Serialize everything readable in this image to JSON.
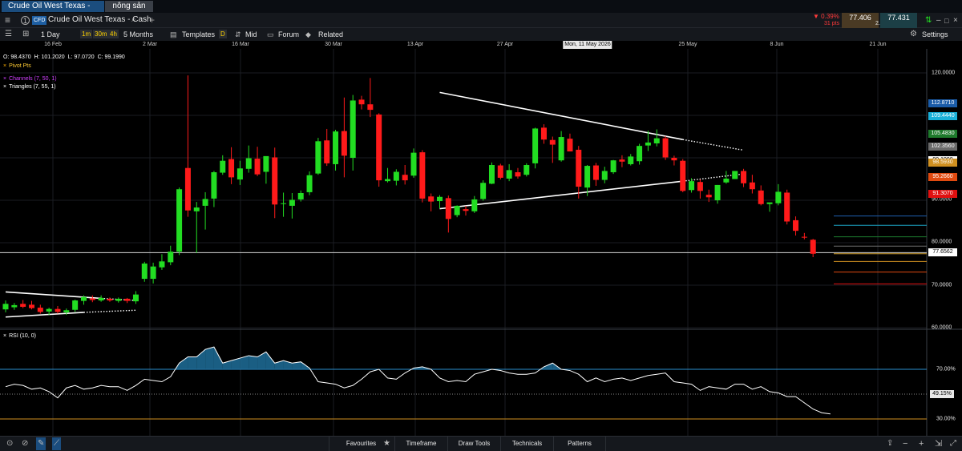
{
  "tabs": [
    {
      "label": "Crude Oil West Texas - Cash",
      "active": true
    },
    {
      "label": "nông sản",
      "active": false
    }
  ],
  "instrument": {
    "number": "1",
    "type_badge": "CFD",
    "name": "Crude Oil West Texas - Cash"
  },
  "quote": {
    "change_pct": "▼ 0.39%",
    "change_pts": "31 pts",
    "sell": "77.406",
    "spread": "2.5",
    "buy": "77.431"
  },
  "toolbar": {
    "timeframe": "1 Day",
    "quick_intervals": [
      "1m",
      "30m",
      "4h"
    ],
    "range": "5 Months",
    "templates": "Templates",
    "d_flag": "D",
    "mid": "Mid",
    "forum": "Forum",
    "related": "Related",
    "settings": "Settings"
  },
  "x_axis": {
    "labels": [
      "16 Feb",
      "2 Mar",
      "16 Mar",
      "30 Mar",
      "13 Apr",
      "27 Apr",
      "25 May",
      "8 Jun",
      "21 Jun"
    ],
    "crosshair_label": "Mon, 11 May 2026"
  },
  "ohlc": {
    "open": "O: 98.4370",
    "high": "H: 101.2020",
    "low": "L: 97.0720",
    "close": "C: 99.1990"
  },
  "indicators": {
    "pivot": "Pivot Pts",
    "channels": "Channels (7, 50, 1)",
    "triangles": "Triangles (7, 55, 1)",
    "rsi": "RSI (10, 0)"
  },
  "price_axis": {
    "labels": [
      "120.0000",
      "90.0000",
      "80.0000",
      "70.0000",
      "60.0000"
    ],
    "tags": [
      {
        "text": "112.8710",
        "color": "#1b5ca8"
      },
      {
        "text": "109.4440",
        "color": "#1ab0d8"
      },
      {
        "text": "105.4830",
        "color": "#1e7a2c"
      },
      {
        "text": "102.3560",
        "color": "#6b6b6b"
      },
      {
        "text": "99.1990",
        "color": "#ffffff"
      },
      {
        "text": "98.5930",
        "color": "#d09020"
      },
      {
        "text": "95.2660",
        "color": "#e04a10"
      },
      {
        "text": "91.3070",
        "color": "#e01010"
      },
      {
        "text": "77.6562",
        "color": "#ffffff"
      }
    ]
  },
  "rsi_axis": {
    "labels": [
      "70.00%",
      "30.00%"
    ],
    "current": "49.15%",
    "overbought": 70,
    "oversold": 30
  },
  "bottom_bar": {
    "items": [
      "Favourites",
      "Timeframe",
      "Draw Tools",
      "Technicals",
      "Patterns"
    ]
  },
  "colors": {
    "bull": "#22dd22",
    "bear": "#ff1a1a",
    "panel": "#15181d",
    "accent_blue": "#1b4d7e"
  },
  "chart_data": {
    "type": "candlestick",
    "instrument": "Crude Oil West Texas - Cash",
    "interval": "1 Day",
    "y_range": [
      60,
      125
    ],
    "candles": [
      {
        "o": 64.3,
        "h": 66.4,
        "l": 63.6,
        "c": 65.6
      },
      {
        "o": 64.8,
        "h": 65.8,
        "l": 64.2,
        "c": 65.3
      },
      {
        "o": 65.6,
        "h": 66.5,
        "l": 64.6,
        "c": 64.9
      },
      {
        "o": 65.4,
        "h": 66.3,
        "l": 64.3,
        "c": 64.6
      },
      {
        "o": 64.7,
        "h": 65.4,
        "l": 63.3,
        "c": 63.7
      },
      {
        "o": 63.8,
        "h": 64.7,
        "l": 63.0,
        "c": 64.4
      },
      {
        "o": 64.4,
        "h": 65.1,
        "l": 63.3,
        "c": 63.7
      },
      {
        "o": 63.6,
        "h": 64.5,
        "l": 63.0,
        "c": 64.1
      },
      {
        "o": 64.2,
        "h": 66.6,
        "l": 63.7,
        "c": 66.4
      },
      {
        "o": 66.3,
        "h": 67.6,
        "l": 65.4,
        "c": 67.2
      },
      {
        "o": 66.9,
        "h": 67.6,
        "l": 66.0,
        "c": 66.5
      },
      {
        "o": 66.4,
        "h": 67.6,
        "l": 66.1,
        "c": 67.0
      },
      {
        "o": 66.8,
        "h": 67.1,
        "l": 66.1,
        "c": 66.4
      },
      {
        "o": 66.3,
        "h": 67.1,
        "l": 65.9,
        "c": 66.8
      },
      {
        "o": 66.8,
        "h": 67.0,
        "l": 65.8,
        "c": 66.3
      },
      {
        "o": 66.2,
        "h": 68.6,
        "l": 65.6,
        "c": 67.8
      },
      {
        "o": 71.5,
        "h": 75.5,
        "l": 70.8,
        "c": 75.1
      },
      {
        "o": 71.5,
        "h": 75.3,
        "l": 70.4,
        "c": 74.4
      },
      {
        "o": 74.2,
        "h": 77.3,
        "l": 73.6,
        "c": 75.6
      },
      {
        "o": 75.4,
        "h": 79.3,
        "l": 74.7,
        "c": 77.9
      },
      {
        "o": 77.9,
        "h": 93.0,
        "l": 77.1,
        "c": 92.6
      },
      {
        "o": 97.6,
        "h": 119.4,
        "l": 86.1,
        "c": 87.6
      },
      {
        "o": 87.4,
        "h": 89.6,
        "l": 77.6,
        "c": 88.3
      },
      {
        "o": 88.7,
        "h": 91.9,
        "l": 83.1,
        "c": 90.3
      },
      {
        "o": 90.4,
        "h": 96.9,
        "l": 88.4,
        "c": 96.6
      },
      {
        "o": 96.5,
        "h": 100.6,
        "l": 96.0,
        "c": 99.3
      },
      {
        "o": 99.7,
        "h": 102.5,
        "l": 93.8,
        "c": 95.4
      },
      {
        "o": 94.9,
        "h": 99.3,
        "l": 93.6,
        "c": 97.5
      },
      {
        "o": 97.4,
        "h": 102.9,
        "l": 96.5,
        "c": 99.9
      },
      {
        "o": 99.8,
        "h": 102.6,
        "l": 95.7,
        "c": 96.1
      },
      {
        "o": 96.7,
        "h": 100.3,
        "l": 93.9,
        "c": 100.4
      },
      {
        "o": 100.1,
        "h": 102.4,
        "l": 85.8,
        "c": 89.0
      },
      {
        "o": 89.3,
        "h": 91.8,
        "l": 86.1,
        "c": 89.3
      },
      {
        "o": 88.7,
        "h": 91.7,
        "l": 85.7,
        "c": 90.1
      },
      {
        "o": 90.2,
        "h": 92.3,
        "l": 89.7,
        "c": 91.7
      },
      {
        "o": 91.9,
        "h": 96.8,
        "l": 91.2,
        "c": 95.9
      },
      {
        "o": 96.3,
        "h": 104.7,
        "l": 96.0,
        "c": 103.9
      },
      {
        "o": 104.1,
        "h": 106.8,
        "l": 98.1,
        "c": 98.7
      },
      {
        "o": 98.5,
        "h": 106.6,
        "l": 97.0,
        "c": 106.2
      },
      {
        "o": 106.3,
        "h": 114.2,
        "l": 95.4,
        "c": 100.5
      },
      {
        "o": 100.0,
        "h": 114.8,
        "l": 97.0,
        "c": 113.5
      },
      {
        "o": 113.7,
        "h": 114.6,
        "l": 111.4,
        "c": 112.6
      },
      {
        "o": 112.6,
        "h": 118.8,
        "l": 109.6,
        "c": 111.3
      },
      {
        "o": 110.2,
        "h": 110.5,
        "l": 93.2,
        "c": 94.7
      },
      {
        "o": 94.5,
        "h": 97.6,
        "l": 94.2,
        "c": 95.0
      },
      {
        "o": 94.6,
        "h": 97.3,
        "l": 93.5,
        "c": 96.7
      },
      {
        "o": 96.0,
        "h": 98.3,
        "l": 93.7,
        "c": 94.7
      },
      {
        "o": 95.8,
        "h": 102.2,
        "l": 95.3,
        "c": 101.2
      },
      {
        "o": 101.3,
        "h": 101.8,
        "l": 89.5,
        "c": 90.4
      },
      {
        "o": 90.9,
        "h": 91.6,
        "l": 87.4,
        "c": 89.7
      },
      {
        "o": 89.8,
        "h": 91.2,
        "l": 88.1,
        "c": 90.8
      },
      {
        "o": 90.5,
        "h": 91.1,
        "l": 82.4,
        "c": 85.6
      },
      {
        "o": 86.5,
        "h": 88.8,
        "l": 86.0,
        "c": 88.7
      },
      {
        "o": 87.9,
        "h": 88.7,
        "l": 86.4,
        "c": 87.5
      },
      {
        "o": 87.4,
        "h": 91.0,
        "l": 87.0,
        "c": 90.2
      },
      {
        "o": 90.3,
        "h": 94.7,
        "l": 89.9,
        "c": 94.1
      },
      {
        "o": 93.9,
        "h": 98.9,
        "l": 93.8,
        "c": 98.3
      },
      {
        "o": 98.2,
        "h": 98.6,
        "l": 94.9,
        "c": 95.3
      },
      {
        "o": 95.1,
        "h": 98.5,
        "l": 94.5,
        "c": 97.1
      },
      {
        "o": 96.6,
        "h": 97.6,
        "l": 95.1,
        "c": 95.6
      },
      {
        "o": 96.0,
        "h": 98.7,
        "l": 95.6,
        "c": 98.3
      },
      {
        "o": 98.7,
        "h": 107.1,
        "l": 97.5,
        "c": 106.9
      },
      {
        "o": 107.1,
        "h": 107.9,
        "l": 103.3,
        "c": 104.3
      },
      {
        "o": 104.2,
        "h": 105.0,
        "l": 98.8,
        "c": 103.1
      },
      {
        "o": 99.4,
        "h": 106.3,
        "l": 99.1,
        "c": 104.9
      },
      {
        "o": 104.5,
        "h": 105.7,
        "l": 101.5,
        "c": 101.5
      },
      {
        "o": 101.9,
        "h": 102.8,
        "l": 90.4,
        "c": 93.2
      },
      {
        "o": 93.0,
        "h": 98.3,
        "l": 91.0,
        "c": 98.1
      },
      {
        "o": 98.2,
        "h": 98.8,
        "l": 93.4,
        "c": 94.8
      },
      {
        "o": 94.8,
        "h": 97.9,
        "l": 94.0,
        "c": 96.9
      },
      {
        "o": 96.6,
        "h": 99.5,
        "l": 96.2,
        "c": 99.4
      },
      {
        "o": 99.6,
        "h": 100.6,
        "l": 97.8,
        "c": 99.1
      },
      {
        "o": 98.5,
        "h": 100.9,
        "l": 98.2,
        "c": 100.3
      },
      {
        "o": 99.2,
        "h": 103.3,
        "l": 98.4,
        "c": 102.8
      },
      {
        "o": 102.9,
        "h": 106.4,
        "l": 101.6,
        "c": 103.6
      },
      {
        "o": 103.4,
        "h": 106.7,
        "l": 102.7,
        "c": 104.6
      },
      {
        "o": 104.6,
        "h": 105.1,
        "l": 99.5,
        "c": 100.1
      },
      {
        "o": 100.0,
        "h": 100.5,
        "l": 98.2,
        "c": 99.4
      },
      {
        "o": 99.3,
        "h": 99.7,
        "l": 91.9,
        "c": 92.2
      },
      {
        "o": 92.4,
        "h": 95.2,
        "l": 91.8,
        "c": 94.5
      },
      {
        "o": 94.3,
        "h": 94.9,
        "l": 90.4,
        "c": 92.2
      },
      {
        "o": 91.3,
        "h": 92.5,
        "l": 89.6,
        "c": 90.7
      },
      {
        "o": 90.0,
        "h": 93.6,
        "l": 89.2,
        "c": 93.6
      },
      {
        "o": 94.2,
        "h": 96.9,
        "l": 93.9,
        "c": 95.1
      },
      {
        "o": 95.0,
        "h": 96.8,
        "l": 95.0,
        "c": 96.9
      },
      {
        "o": 96.9,
        "h": 97.4,
        "l": 93.1,
        "c": 94.0
      },
      {
        "o": 94.2,
        "h": 96.0,
        "l": 91.6,
        "c": 92.6
      },
      {
        "o": 92.3,
        "h": 93.5,
        "l": 88.8,
        "c": 89.1
      },
      {
        "o": 89.1,
        "h": 89.4,
        "l": 87.3,
        "c": 89.5
      },
      {
        "o": 89.3,
        "h": 93.8,
        "l": 88.8,
        "c": 92.0
      },
      {
        "o": 91.8,
        "h": 92.5,
        "l": 84.3,
        "c": 85.0
      },
      {
        "o": 85.3,
        "h": 86.2,
        "l": 81.7,
        "c": 82.8
      },
      {
        "o": 81.4,
        "h": 82.3,
        "l": 80.8,
        "c": 81.2
      },
      {
        "o": 80.7,
        "h": 80.9,
        "l": 76.6,
        "c": 77.4
      }
    ],
    "pivot_levels": [
      {
        "value": 86.3,
        "color": "#1f5fb0"
      },
      {
        "value": 84.1,
        "color": "#1aa0c0"
      },
      {
        "value": 81.4,
        "color": "#1e8030"
      },
      {
        "value": 79.2,
        "color": "#707070"
      },
      {
        "value": 77.4,
        "color": "#d0a030"
      },
      {
        "value": 75.6,
        "color": "#d09020"
      },
      {
        "value": 73.1,
        "color": "#e04a10"
      },
      {
        "value": 70.3,
        "color": "#e01010"
      }
    ],
    "current_price_line": 77.6562,
    "rsi": [
      56,
      58,
      57,
      54,
      55,
      52,
      47,
      55,
      57,
      54,
      55,
      57,
      56,
      56,
      53,
      57,
      62,
      61,
      60,
      64,
      75,
      80,
      80,
      86,
      88,
      75,
      77,
      79,
      81,
      80,
      84,
      75,
      77,
      75,
      76,
      71,
      60,
      59,
      58,
      55,
      57,
      62,
      68,
      70,
      63,
      62,
      67,
      71,
      72,
      70,
      63,
      60,
      61,
      60,
      66,
      68,
      70,
      69,
      67,
      66,
      66,
      67,
      72,
      75,
      70,
      69,
      66,
      60,
      63,
      60,
      62,
      63,
      61,
      63,
      65,
      66,
      67,
      60,
      59,
      58,
      53,
      56,
      55,
      54,
      58,
      58,
      54,
      56,
      52,
      51,
      48,
      48,
      43,
      38,
      35,
      34
    ],
    "rsi_range": [
      15,
      95
    ],
    "trendlines": [
      {
        "from": [
          0,
          68.4
        ],
        "to": [
          11,
          66.9
        ],
        "style": "solid"
      },
      {
        "from": [
          11,
          66.9
        ],
        "to": [
          15,
          66.4
        ],
        "style": "dotted"
      },
      {
        "from": [
          0,
          62.5
        ],
        "to": [
          9,
          63.6
        ],
        "style": "solid"
      },
      {
        "from": [
          9,
          63.6
        ],
        "to": [
          15,
          64.1
        ],
        "style": "dotted"
      },
      {
        "from": [
          50,
          115.4
        ],
        "to": [
          78,
          104.3
        ],
        "style": "solid"
      },
      {
        "from": [
          78,
          104.3
        ],
        "to": [
          85,
          101.8
        ],
        "style": "dotted"
      },
      {
        "from": [
          50,
          88.0
        ],
        "to": [
          78,
          94.5
        ],
        "style": "solid"
      },
      {
        "from": [
          78,
          94.5
        ],
        "to": [
          85,
          96.2
        ],
        "style": "dotted"
      }
    ]
  }
}
